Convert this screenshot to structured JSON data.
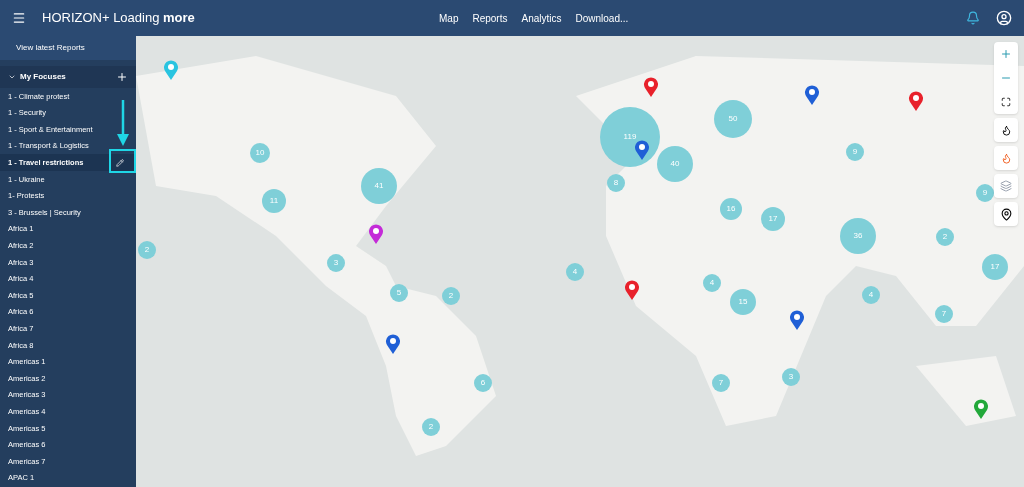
{
  "header": {
    "title": "HORIZON+ Loading **more**",
    "nav": [
      "Map",
      "Reports",
      "Analytics",
      "Download..."
    ]
  },
  "sidebar": {
    "link": "View latest Reports",
    "section": {
      "title": "My Focuses",
      "expanded": true
    },
    "items": [
      {
        "label": "1 - Climate protest",
        "selected": false
      },
      {
        "label": "1 - Security",
        "selected": false
      },
      {
        "label": "1 - Sport & Entertainment",
        "selected": false
      },
      {
        "label": "1 - Transport & Logistics",
        "selected": false
      },
      {
        "label": "1 - Travel restrictions",
        "selected": true
      },
      {
        "label": "1 - Ukraine",
        "selected": false
      },
      {
        "label": "1- Protests",
        "selected": false
      },
      {
        "label": "3 - Brussels | Security",
        "selected": false
      },
      {
        "label": "Africa 1",
        "selected": false
      },
      {
        "label": "Africa 2",
        "selected": false
      },
      {
        "label": "Africa 3",
        "selected": false
      },
      {
        "label": "Africa 4",
        "selected": false
      },
      {
        "label": "Africa 5",
        "selected": false
      },
      {
        "label": "Africa 6",
        "selected": false
      },
      {
        "label": "Africa 7",
        "selected": false
      },
      {
        "label": "Africa 8",
        "selected": false
      },
      {
        "label": "Americas 1",
        "selected": false
      },
      {
        "label": "Americas 2",
        "selected": false
      },
      {
        "label": "Americas 3",
        "selected": false
      },
      {
        "label": "Americas 4",
        "selected": false
      },
      {
        "label": "Americas 5",
        "selected": false
      },
      {
        "label": "Americas 6",
        "selected": false
      },
      {
        "label": "Americas 7",
        "selected": false
      },
      {
        "label": "APAC 1",
        "selected": false
      }
    ]
  },
  "map": {
    "clusters": [
      "10",
      "41",
      "11",
      "2",
      "3",
      "5",
      "2",
      "6",
      "2",
      "119",
      "50",
      "40",
      "8",
      "16",
      "17",
      "36",
      "9",
      "2",
      "17",
      "9",
      "4",
      "4",
      "15",
      "4",
      "7",
      "7",
      "3"
    ],
    "pins": [
      {
        "color": "#29c4e0"
      },
      {
        "color": "#e8212b"
      },
      {
        "color": "#1f5fd6"
      },
      {
        "color": "#e8212b"
      },
      {
        "color": "#1f5fd6"
      },
      {
        "color": "#c42ad8"
      },
      {
        "color": "#e8212b"
      },
      {
        "color": "#1f5fd6"
      },
      {
        "color": "#1f5fd6"
      },
      {
        "color": "#22a83a"
      }
    ]
  }
}
